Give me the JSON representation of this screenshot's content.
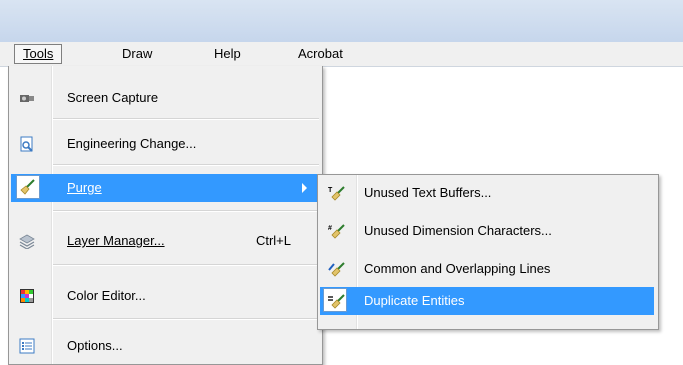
{
  "menubar": {
    "items": [
      {
        "label": "Tools",
        "active": true
      },
      {
        "label": "Draw",
        "active": false
      },
      {
        "label": "Help",
        "active": false
      },
      {
        "label": "Acrobat",
        "active": false
      }
    ]
  },
  "tools_menu": {
    "items": [
      {
        "label": "Screen Capture",
        "icon": "camera-icon"
      },
      {
        "label": "Engineering Change...",
        "icon": "document-magnifier-icon"
      },
      {
        "label": "Purge",
        "icon": "broom-icon",
        "highlighted": true,
        "has_submenu": true
      },
      {
        "label": "Layer Manager...",
        "shortcut": "Ctrl+L",
        "icon": "layers-icon"
      },
      {
        "label": "Color Editor...",
        "icon": "color-grid-icon"
      },
      {
        "label": "Options...",
        "icon": "options-list-icon"
      }
    ]
  },
  "purge_submenu": {
    "items": [
      {
        "label": "Unused Text Buffers...",
        "icon": "broom-text-icon"
      },
      {
        "label": "Unused Dimension Characters...",
        "icon": "broom-hash-icon"
      },
      {
        "label": "Common and Overlapping Lines",
        "icon": "broom-lines-icon"
      },
      {
        "label": "Duplicate Entities",
        "icon": "broom-equals-icon",
        "highlighted": true
      }
    ]
  },
  "colors": {
    "highlight": "#3399ff",
    "menu_bg": "#f0f0f0"
  }
}
